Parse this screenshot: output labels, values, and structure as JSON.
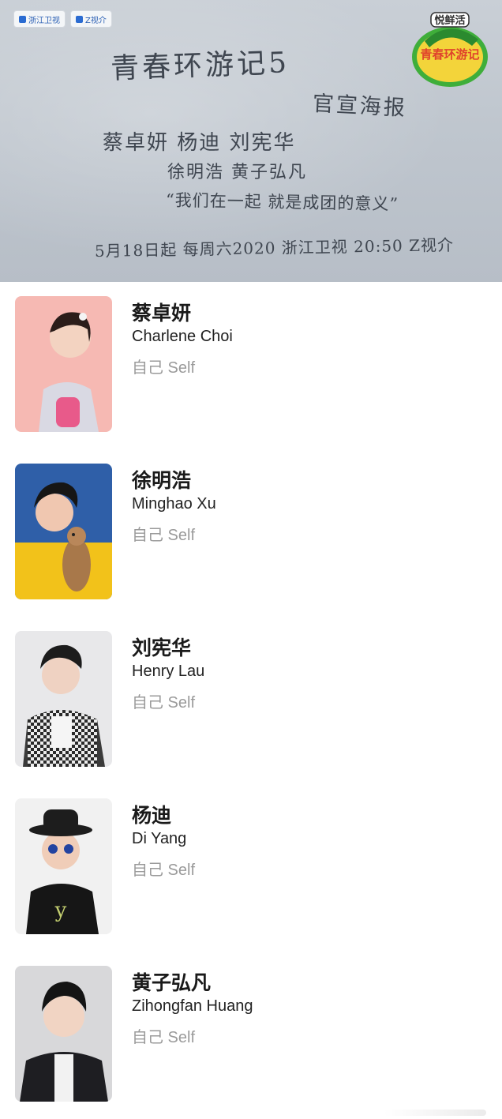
{
  "poster": {
    "badges": [
      "浙江卫视",
      "Z视介"
    ],
    "logo_text": "悦鲜活",
    "logo_title": "青春环游记",
    "lines": {
      "title": "青春环游记5",
      "subtitle": "官宣海报",
      "names1": "蔡卓妍   杨迪   刘宪华",
      "names2": "徐明浩   黄子弘凡",
      "quote": "“我们在一起 就是成团的意义”",
      "date": "5月18日起 每周六2020 浙江卫视 20:50 Z视介"
    }
  },
  "cast": [
    {
      "name_cn": "蔡卓妍",
      "name_en": "Charlene Choi",
      "role": "自己 Self",
      "photo_icon": "portrait-pink-background"
    },
    {
      "name_cn": "徐明浩",
      "name_en": "Minghao Xu",
      "role": "自己 Self",
      "photo_icon": "portrait-blue-yellow-meerkat"
    },
    {
      "name_cn": "刘宪华",
      "name_en": "Henry Lau",
      "role": "自己 Self",
      "photo_icon": "portrait-checkered-jacket"
    },
    {
      "name_cn": "杨迪",
      "name_en": "Di Yang",
      "role": "自己 Self",
      "photo_icon": "portrait-hat-sunglasses"
    },
    {
      "name_cn": "黄子弘凡",
      "name_en": "Zihongfan Huang",
      "role": "自己 Self",
      "photo_icon": "portrait-dark-jacket"
    }
  ]
}
